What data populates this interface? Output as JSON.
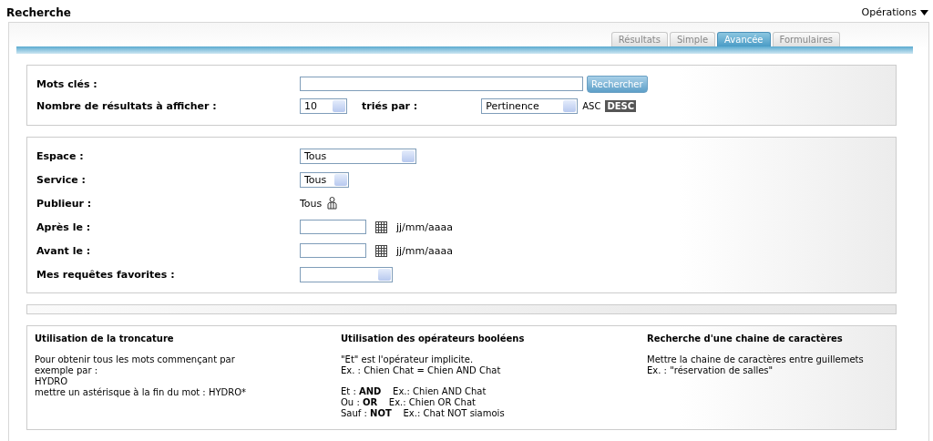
{
  "header": {
    "title": "Recherche",
    "menu": "Opérations"
  },
  "tabs": [
    {
      "label": "Résultats",
      "selected": false
    },
    {
      "label": "Simple",
      "selected": false
    },
    {
      "label": "Avancée",
      "selected": true
    },
    {
      "label": "Formulaires",
      "selected": false
    }
  ],
  "basic": {
    "keywords_label": "Mots clés :",
    "search_button": "Rechercher",
    "count_label": "Nombre de résultats à afficher :",
    "count_value": "10",
    "sort_label": "triés par :",
    "sort_value": "Pertinence",
    "orders": [
      {
        "label": "ASC",
        "selected": false
      },
      {
        "label": "DESC",
        "selected": true
      }
    ]
  },
  "filters": [
    {
      "kind": "select",
      "label": "Espace :",
      "value": "Tous"
    },
    {
      "kind": "select",
      "label": "Service :",
      "value": "Tous"
    },
    {
      "kind": "picker",
      "label": "Publieur :",
      "value": "Tous"
    },
    {
      "kind": "date",
      "label": "Après le :",
      "hint": "jj/mm/aaaa"
    },
    {
      "kind": "date",
      "label": "Avant le :",
      "hint": "jj/mm/aaaa"
    },
    {
      "kind": "select",
      "label": "Mes requêtes favorites :"
    }
  ],
  "help": [
    {
      "title": "Utilisation de la troncature",
      "paragraphs": [
        [
          "Pour obtenir tous les mots commençant par",
          "exemple par :",
          "HYDRO",
          "mettre un astérisque à la fin du mot : HYDRO*"
        ]
      ]
    },
    {
      "title": "Utilisation des opérateurs booléens",
      "paragraphs": [
        [
          "\"Et\" est l'opérateur implicite.",
          "Ex. : Chien Chat = Chien AND Chat"
        ],
        [
          "Et : **AND**    Ex.: Chien AND Chat",
          "Ou : **OR**    Ex.: Chien OR Chat",
          "Sauf : **NOT**    Ex.: Chat NOT siamois"
        ]
      ]
    },
    {
      "title": "Recherche d'une chaine de caractères",
      "paragraphs": [
        [
          "Mettre la chaine de caractères entre guillemets",
          "Ex. : \"réservation de salles\""
        ]
      ]
    }
  ]
}
